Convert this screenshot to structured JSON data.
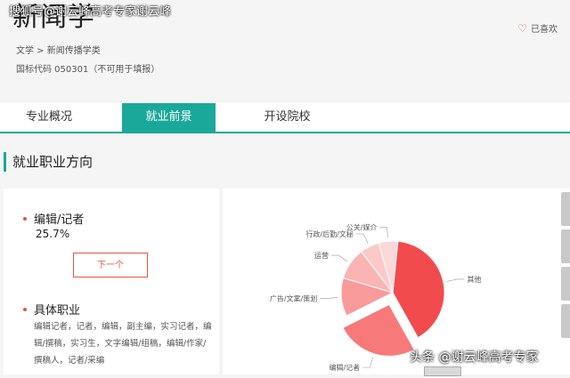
{
  "header": {
    "major_title": "新闻学",
    "watermark": "搜狐号@谢云峰高考专家谢云峰",
    "breadcrumb": "文学 > 新闻传播学类",
    "code": "国标代码 050301（不可用于填报）",
    "favorite_label": "已喜欢"
  },
  "tabs": [
    {
      "label": "专业概况"
    },
    {
      "label": "就业前景"
    },
    {
      "label": "开设院校"
    }
  ],
  "section_title": "就业职业方向",
  "job": {
    "name": "编辑/记者",
    "percent": "25.7%",
    "next_label": "下一个"
  },
  "specific": {
    "title": "具体职业",
    "text": "编辑记者，记者，编辑，副主编，实习记者，编辑/撰稿，实习生，文字编辑/组稿，编辑/作家/撰稿人，记者/采编"
  },
  "colors": {
    "accent": "#1aa89a",
    "highlight": "#e0583a",
    "pie": [
      "#f24b4e",
      "#f7797a",
      "#f99a9b",
      "#fab4b4",
      "#fcc9c9",
      "#fdd8d8"
    ]
  },
  "chart_data": {
    "type": "pie",
    "categories": [
      "其他",
      "编辑/记者",
      "广告/文案/策划",
      "运营",
      "行政/后勤/文秘",
      "公关/媒介"
    ],
    "values": [
      40.3,
      25.7,
      12.0,
      10.0,
      6.0,
      6.0
    ],
    "exploded": "编辑/记者"
  },
  "caption": "头条 @谢云峰高考专家"
}
